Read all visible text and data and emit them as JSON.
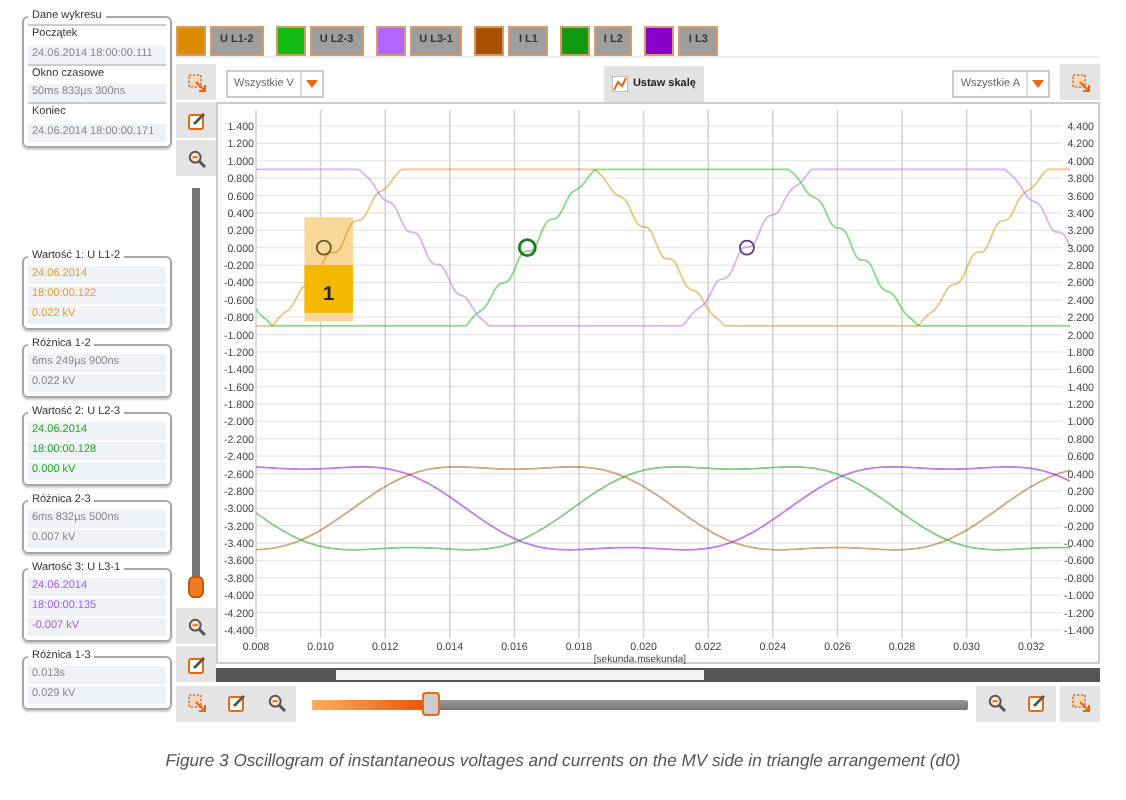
{
  "info_panel": {
    "groups": [
      {
        "kind": "fields",
        "title": "Dane wykresu",
        "fields": [
          {
            "label": "Początek",
            "value": "24.06.2014 18:00:00.111"
          },
          {
            "label": "Okno czasowe",
            "value": "50ms 833µs 300ns"
          },
          {
            "label": "Koniec",
            "value": "24.06.2014 18:00:00.171"
          }
        ]
      },
      {
        "kind": "values",
        "title": "Wartość 1: U L1-2",
        "color": "#e0a030",
        "rows": [
          "24.06.2014",
          "18:00:00.122",
          "0.022 kV"
        ]
      },
      {
        "kind": "difference",
        "title": "Różnica 1-2",
        "rows": [
          "6ms 249µs 900ns",
          "0.022 kV"
        ]
      },
      {
        "kind": "values",
        "title": "Wartość 2: U L2-3",
        "color": "#22aa22",
        "rows": [
          "24.06.2014",
          "18:00:00.128",
          "0.000 kV"
        ]
      },
      {
        "kind": "difference",
        "title": "Różnica 2-3",
        "rows": [
          "6ms 832µs 500ns",
          "0.007 kV"
        ]
      },
      {
        "kind": "values",
        "title": "Wartość 3: U L3-1",
        "color": "#a060f0",
        "rows": [
          "24.06.2014",
          "18:00:00.135",
          "-0.007 kV"
        ]
      },
      {
        "kind": "difference",
        "title": "Różnica 1-3",
        "rows": [
          "0.013s",
          "0.029 kV"
        ]
      }
    ]
  },
  "legend": [
    {
      "label": "U L1-2",
      "color": "#d98c00"
    },
    {
      "label": "U L2-3",
      "color": "#11bb11"
    },
    {
      "label": "U L3-1",
      "color": "#b266ff"
    },
    {
      "label": "I L1",
      "color": "#a65200"
    },
    {
      "label": "I L2",
      "color": "#119911"
    },
    {
      "label": "I L3",
      "color": "#8800cc"
    }
  ],
  "toolbar": {
    "voltage_filter": "Wszystkie V",
    "scale_button": "Ustaw skalę",
    "current_filter": "Wszystkie A"
  },
  "vertical_zoom": {
    "level": 0
  },
  "chart": {
    "y_left_ticks": [
      "1.400",
      "1.200",
      "1.000",
      "0.800",
      "0.600",
      "0.400",
      "0.200",
      "0.000",
      "-0.200",
      "-0.400",
      "-0.600",
      "-0.800",
      "-1.000",
      "-1.200",
      "-1.400",
      "-1.600",
      "-1.800",
      "-2.000",
      "-2.200",
      "-2.400",
      "-2.600",
      "-2.800",
      "-3.000",
      "-3.200",
      "-3.400",
      "-3.600",
      "-3.800",
      "-4.000",
      "-4.200",
      "-4.400"
    ],
    "y_right_ticks": [
      "4.400",
      "4.200",
      "4.000",
      "3.800",
      "3.600",
      "3.400",
      "3.200",
      "3.000",
      "2.800",
      "2.600",
      "2.400",
      "2.200",
      "2.000",
      "1.800",
      "1.600",
      "1.400",
      "1.200",
      "1.000",
      "0.800",
      "0.600",
      "0.400",
      "0.200",
      "0.000",
      "-0.200",
      "-0.400",
      "-0.600",
      "-0.800",
      "-1.000",
      "-1.200",
      "-1.400"
    ],
    "x_ticks": [
      "0.008",
      "0.010",
      "0.012",
      "0.014",
      "0.016",
      "0.018",
      "0.020",
      "0.022",
      "0.024",
      "0.026",
      "0.028",
      "0.030",
      "0.032"
    ],
    "xlabel": "[sekunda.msekunda]",
    "marker_label": "1",
    "cursors": [
      {
        "color": "#6b5a2a"
      },
      {
        "color": "#1f7a1f"
      },
      {
        "color": "#5a3f7a"
      }
    ]
  },
  "time_zoom": {
    "level": 0.18
  },
  "caption": "Figure 3 Oscillogram of instantaneous voltages and currents on the MV side in triangle arrangement (d0)"
}
